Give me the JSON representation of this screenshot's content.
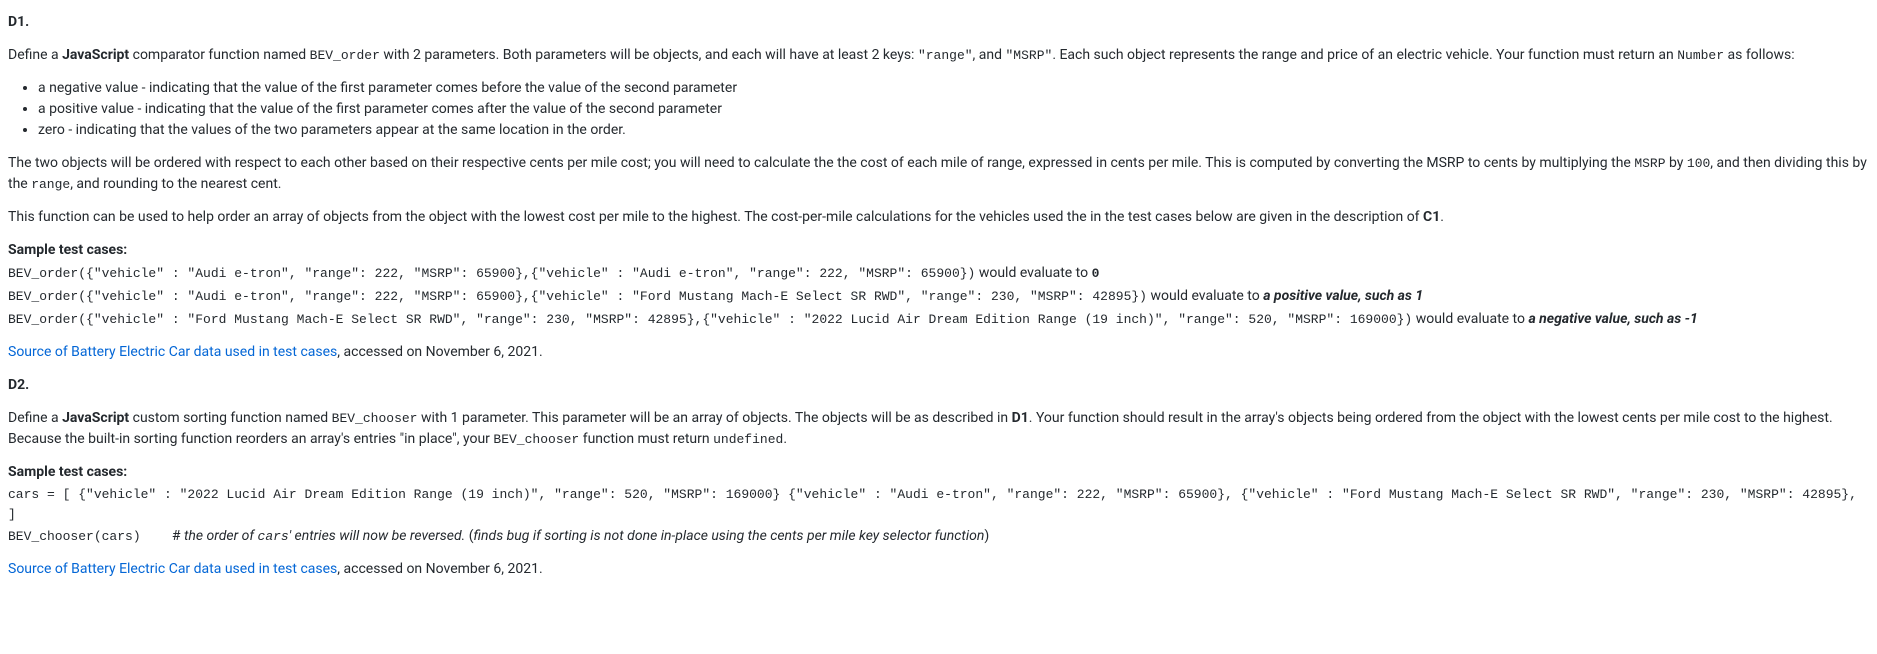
{
  "d1": {
    "heading": "D1.",
    "p1_a": "Define a ",
    "p1_b": "JavaScript",
    "p1_c": " comparator function named ",
    "p1_d": "BEV_order",
    "p1_e": " with 2 parameters. Both parameters will be objects, and each will have at least 2 keys: ",
    "p1_f": "\"range\"",
    "p1_g": ", and ",
    "p1_h": "\"MSRP\"",
    "p1_i": ". Each such object represents the range and price of an electric vehicle. Your function must return an ",
    "p1_j": "Number",
    "p1_k": " as follows:",
    "bullets": [
      "a negative value - indicating that the value of the first parameter comes before the value of the second parameter",
      "a positive value - indicating that the value of the first parameter comes after the value of the second parameter",
      "zero - indicating that the values of the two parameters appear at the same location in the order."
    ],
    "p2_a": "The two objects will be ordered with respect to each other based on their respective cents per mile cost; you will need to calculate the the cost of each mile of range, expressed in cents per mile. This is computed by converting the MSRP to cents by multiplying the ",
    "p2_b": "MSRP",
    "p2_c": " by ",
    "p2_d": "100",
    "p2_e": ", and then dividing this by the ",
    "p2_f": "range",
    "p2_g": ", and rounding to the nearest cent.",
    "p3_a": "This function can be used to help order an array of objects from the object with the lowest cost per mile to the highest. The cost-per-mile calculations for the vehicles used the in the test cases below are given in the description of ",
    "p3_b": "C1",
    "p3_c": ".",
    "sample_label": "Sample test cases:",
    "t1_code": "BEV_order({\"vehicle\" : \"Audi e-tron\", \"range\": 222, \"MSRP\": 65900},{\"vehicle\" : \"Audi e-tron\", \"range\": 222, \"MSRP\": 65900})",
    "t1_mid": " would evaluate to ",
    "t1_res": "0",
    "t2_code": "BEV_order({\"vehicle\" : \"Audi e-tron\", \"range\": 222, \"MSRP\": 65900},{\"vehicle\" : \"Ford Mustang Mach-E Select SR RWD\", \"range\": 230, \"MSRP\": 42895})",
    "t2_mid": " would evaluate to ",
    "t2_res": "a positive value, such as 1",
    "t3_code": "BEV_order({\"vehicle\" : \"Ford Mustang Mach-E Select SR RWD\", \"range\": 230, \"MSRP\": 42895},{\"vehicle\" : \"2022 Lucid Air Dream Edition Range (19 inch)\", \"range\": 520, \"MSRP\": 169000})",
    "t3_mid": " would evaluate to ",
    "t3_res": "a negative value, such as -1",
    "src_link": "Source of Battery Electric Car data used in test cases",
    "src_tail": ", accessed on November 6, 2021."
  },
  "d2": {
    "heading": "D2.",
    "p1_a": "Define a ",
    "p1_b": "JavaScript",
    "p1_c": " custom sorting function named ",
    "p1_d": "BEV_chooser",
    "p1_e": " with 1 parameter. This parameter will be an array of objects. The objects will be as described in ",
    "p1_f": "D1",
    "p1_g": ". Your function should result in the array's objects being ordered from the object with the lowest cents per mile cost to the highest. Because the built-in sorting function reorders an array's entries \"in place\", your ",
    "p1_h": "BEV_chooser",
    "p1_i": " function must return ",
    "p1_j": "undefined",
    "p1_k": ".",
    "sample_label": "Sample test cases:",
    "t1_code": "cars = [ {\"vehicle\" : \"2022 Lucid Air Dream Edition Range (19 inch)\", \"range\": 520, \"MSRP\": 169000} {\"vehicle\" : \"Audi e-tron\", \"range\": 222, \"MSRP\": 65900}, {\"vehicle\" : \"Ford Mustang Mach-E Select SR RWD\", \"range\": 230, \"MSRP\": 42895}, ]",
    "t2_code": "BEV_chooser(cars)",
    "t2_gap": "    ",
    "t2_hash": "# ",
    "t2_it_a": "the order of ",
    "t2_it_b": "cars",
    "t2_it_c": "' entries will now be reversed.",
    "t2_plain": " (",
    "t2_it_d": "finds bug if sorting is not done in-place using the cents per mile key selector function",
    "t2_tail": ")",
    "src_link": "Source of Battery Electric Car data used in test cases",
    "src_tail": ", accessed on November 6, 2021."
  }
}
